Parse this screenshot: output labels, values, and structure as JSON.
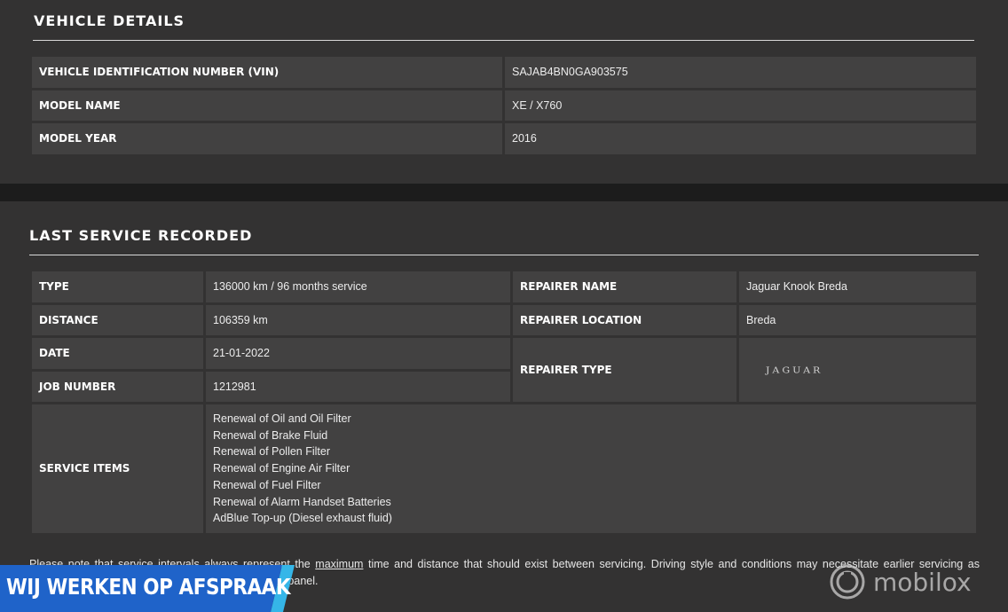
{
  "vehicle_details": {
    "title": "VEHICLE DETAILS",
    "rows": [
      {
        "label": "VEHICLE IDENTIFICATION NUMBER (VIN)",
        "value": "SAJAB4BN0GA903575"
      },
      {
        "label": "MODEL NAME",
        "value": "XE / X760"
      },
      {
        "label": "MODEL YEAR",
        "value": "2016"
      }
    ]
  },
  "last_service": {
    "title": "LAST SERVICE RECORDED",
    "type_label": "TYPE",
    "type_value": "136000 km / 96 months service",
    "distance_label": "DISTANCE",
    "distance_value": "106359 km",
    "date_label": "DATE",
    "date_value": "21-01-2022",
    "job_number_label": "JOB NUMBER",
    "job_number_value": "1212981",
    "repairer_name_label": "REPAIRER NAME",
    "repairer_name_value": "Jaguar Knook Breda",
    "repairer_location_label": "REPAIRER LOCATION",
    "repairer_location_value": "Breda",
    "repairer_type_label": "REPAIRER TYPE",
    "repairer_type_logo": "JAGUAR",
    "service_items_label": "SERVICE ITEMS",
    "service_items": [
      "Renewal of Oil and Oil Filter",
      "Renewal of Brake Fluid",
      "Renewal of Pollen Filter",
      "Renewal of Engine Air Filter",
      "Renewal of Fuel Filter",
      "Renewal of Alarm Handset Batteries",
      "AdBlue Top-up (Diesel exhaust fluid)"
    ]
  },
  "note": {
    "before": "Please note that service intervals always represent the ",
    "link": "maximum",
    "after": " time and distance that should exist between servicing. Driving style and conditions may necessitate earlier servicing as indicated by the vehicle's on-board service reminder panel."
  },
  "banner": {
    "text": "WIJ WERKEN OP AFSPRAAK",
    "bg_color": "#1f63c9",
    "stripe_color": "#35b6e8"
  },
  "watermark": {
    "text": "mobilox",
    "icon": "mobilox-logo-icon"
  }
}
